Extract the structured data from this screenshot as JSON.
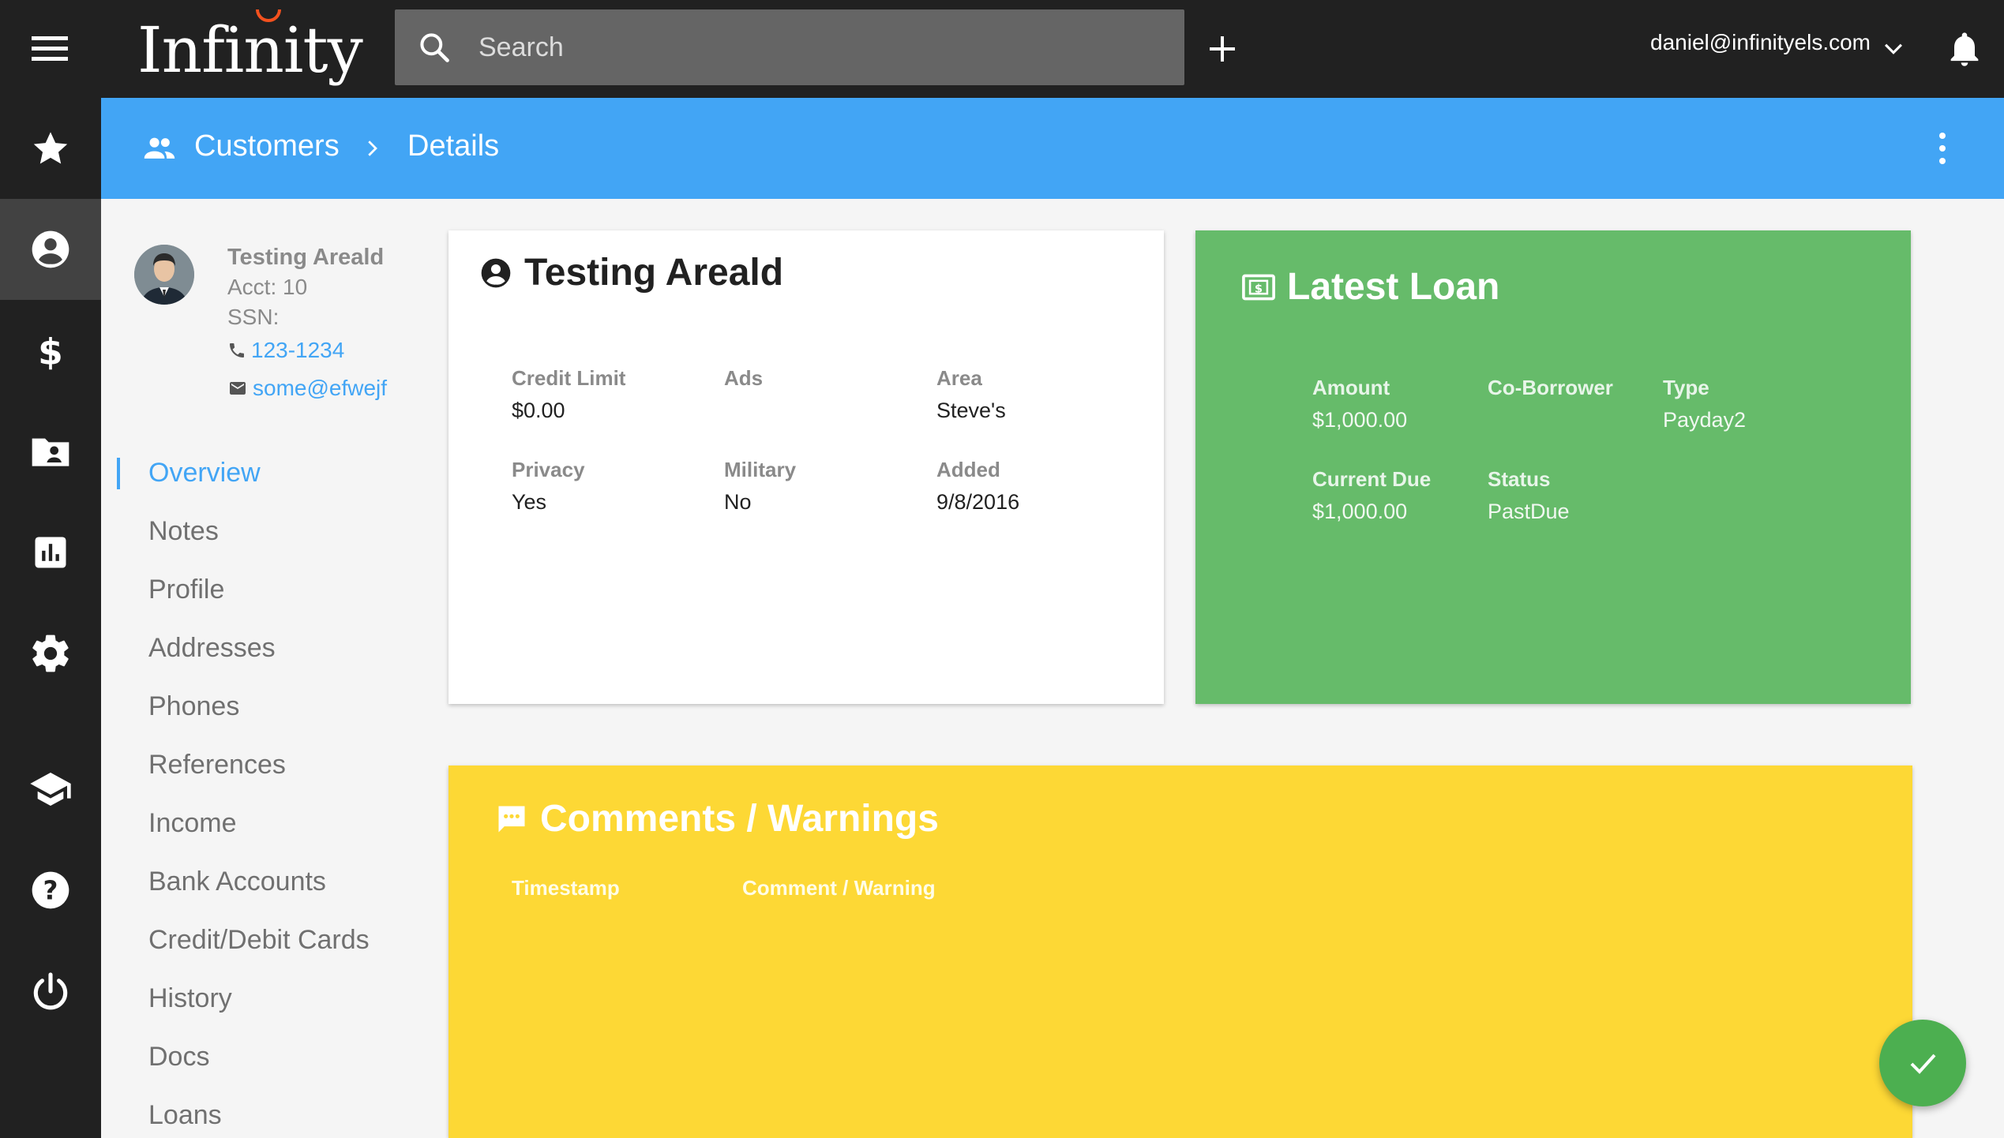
{
  "app": {
    "logo_text": "Infinity"
  },
  "topbar": {
    "search_placeholder": "Search",
    "user_email": "daniel@infinityels.com"
  },
  "rail": {
    "items": [
      {
        "icon": "star-icon",
        "active": false
      },
      {
        "icon": "account-circle-icon",
        "active": true
      },
      {
        "icon": "dollar-icon",
        "active": false
      },
      {
        "icon": "folder-account-icon",
        "active": false
      },
      {
        "icon": "bar-chart-icon",
        "active": false
      },
      {
        "icon": "gear-icon",
        "active": false
      },
      {
        "icon": "school-icon",
        "active": false
      },
      {
        "icon": "help-icon",
        "active": false
      },
      {
        "icon": "power-icon",
        "active": false
      }
    ]
  },
  "breadcrumb": {
    "section": "Customers",
    "page": "Details"
  },
  "profile": {
    "name": "Testing Areald",
    "acct": "Acct: 10",
    "ssn": "SSN:",
    "phone": "123-1234",
    "email": "some@efwejf"
  },
  "nav": {
    "items": [
      {
        "label": "Overview",
        "active": true
      },
      {
        "label": "Notes"
      },
      {
        "label": "Profile"
      },
      {
        "label": "Addresses"
      },
      {
        "label": "Phones"
      },
      {
        "label": "References"
      },
      {
        "label": "Income"
      },
      {
        "label": "Bank Accounts"
      },
      {
        "label": "Credit/Debit Cards"
      },
      {
        "label": "History"
      },
      {
        "label": "Docs"
      },
      {
        "label": "Loans"
      }
    ]
  },
  "customer_card": {
    "title": "Testing Areald",
    "fields": [
      {
        "label": "Credit Limit",
        "value": "$0.00"
      },
      {
        "label": "Ads",
        "value": ""
      },
      {
        "label": "Area",
        "value": "Steve's"
      },
      {
        "label": "Privacy",
        "value": "Yes"
      },
      {
        "label": "Military",
        "value": "No"
      },
      {
        "label": "Added",
        "value": "9/8/2016"
      }
    ]
  },
  "loan_card": {
    "title": "Latest Loan",
    "fields": [
      {
        "label": "Amount",
        "value": "$1,000.00"
      },
      {
        "label": "Co-Borrower",
        "value": ""
      },
      {
        "label": "Type",
        "value": "Payday2"
      },
      {
        "label": "Current Due",
        "value": "$1,000.00"
      },
      {
        "label": "Status",
        "value": "PastDue"
      }
    ]
  },
  "comments_card": {
    "title": "Comments / Warnings",
    "columns": [
      "Timestamp",
      "Comment / Warning"
    ]
  },
  "colors": {
    "topbar": "#212121",
    "accent": "#42a5f5",
    "loan_card": "#66bb6a",
    "comments_card": "#fdd835",
    "fab": "#4caf50"
  }
}
